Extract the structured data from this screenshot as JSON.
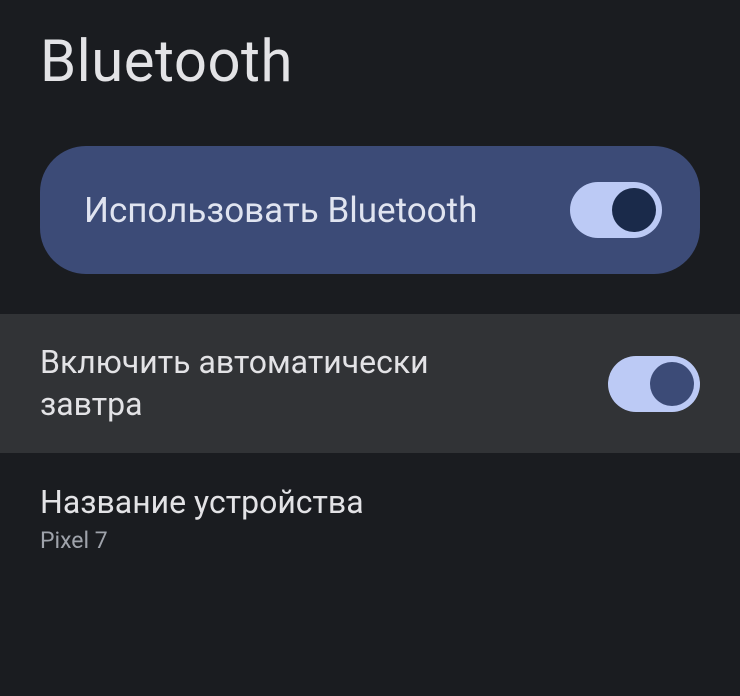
{
  "header": {
    "title": "Bluetooth"
  },
  "mainToggle": {
    "label": "Использовать Bluetooth",
    "enabled": true
  },
  "autoEnableToggle": {
    "label": "Включить автоматически завтра",
    "enabled": true
  },
  "deviceName": {
    "label": "Название устройства",
    "value": "Pixel 7"
  }
}
